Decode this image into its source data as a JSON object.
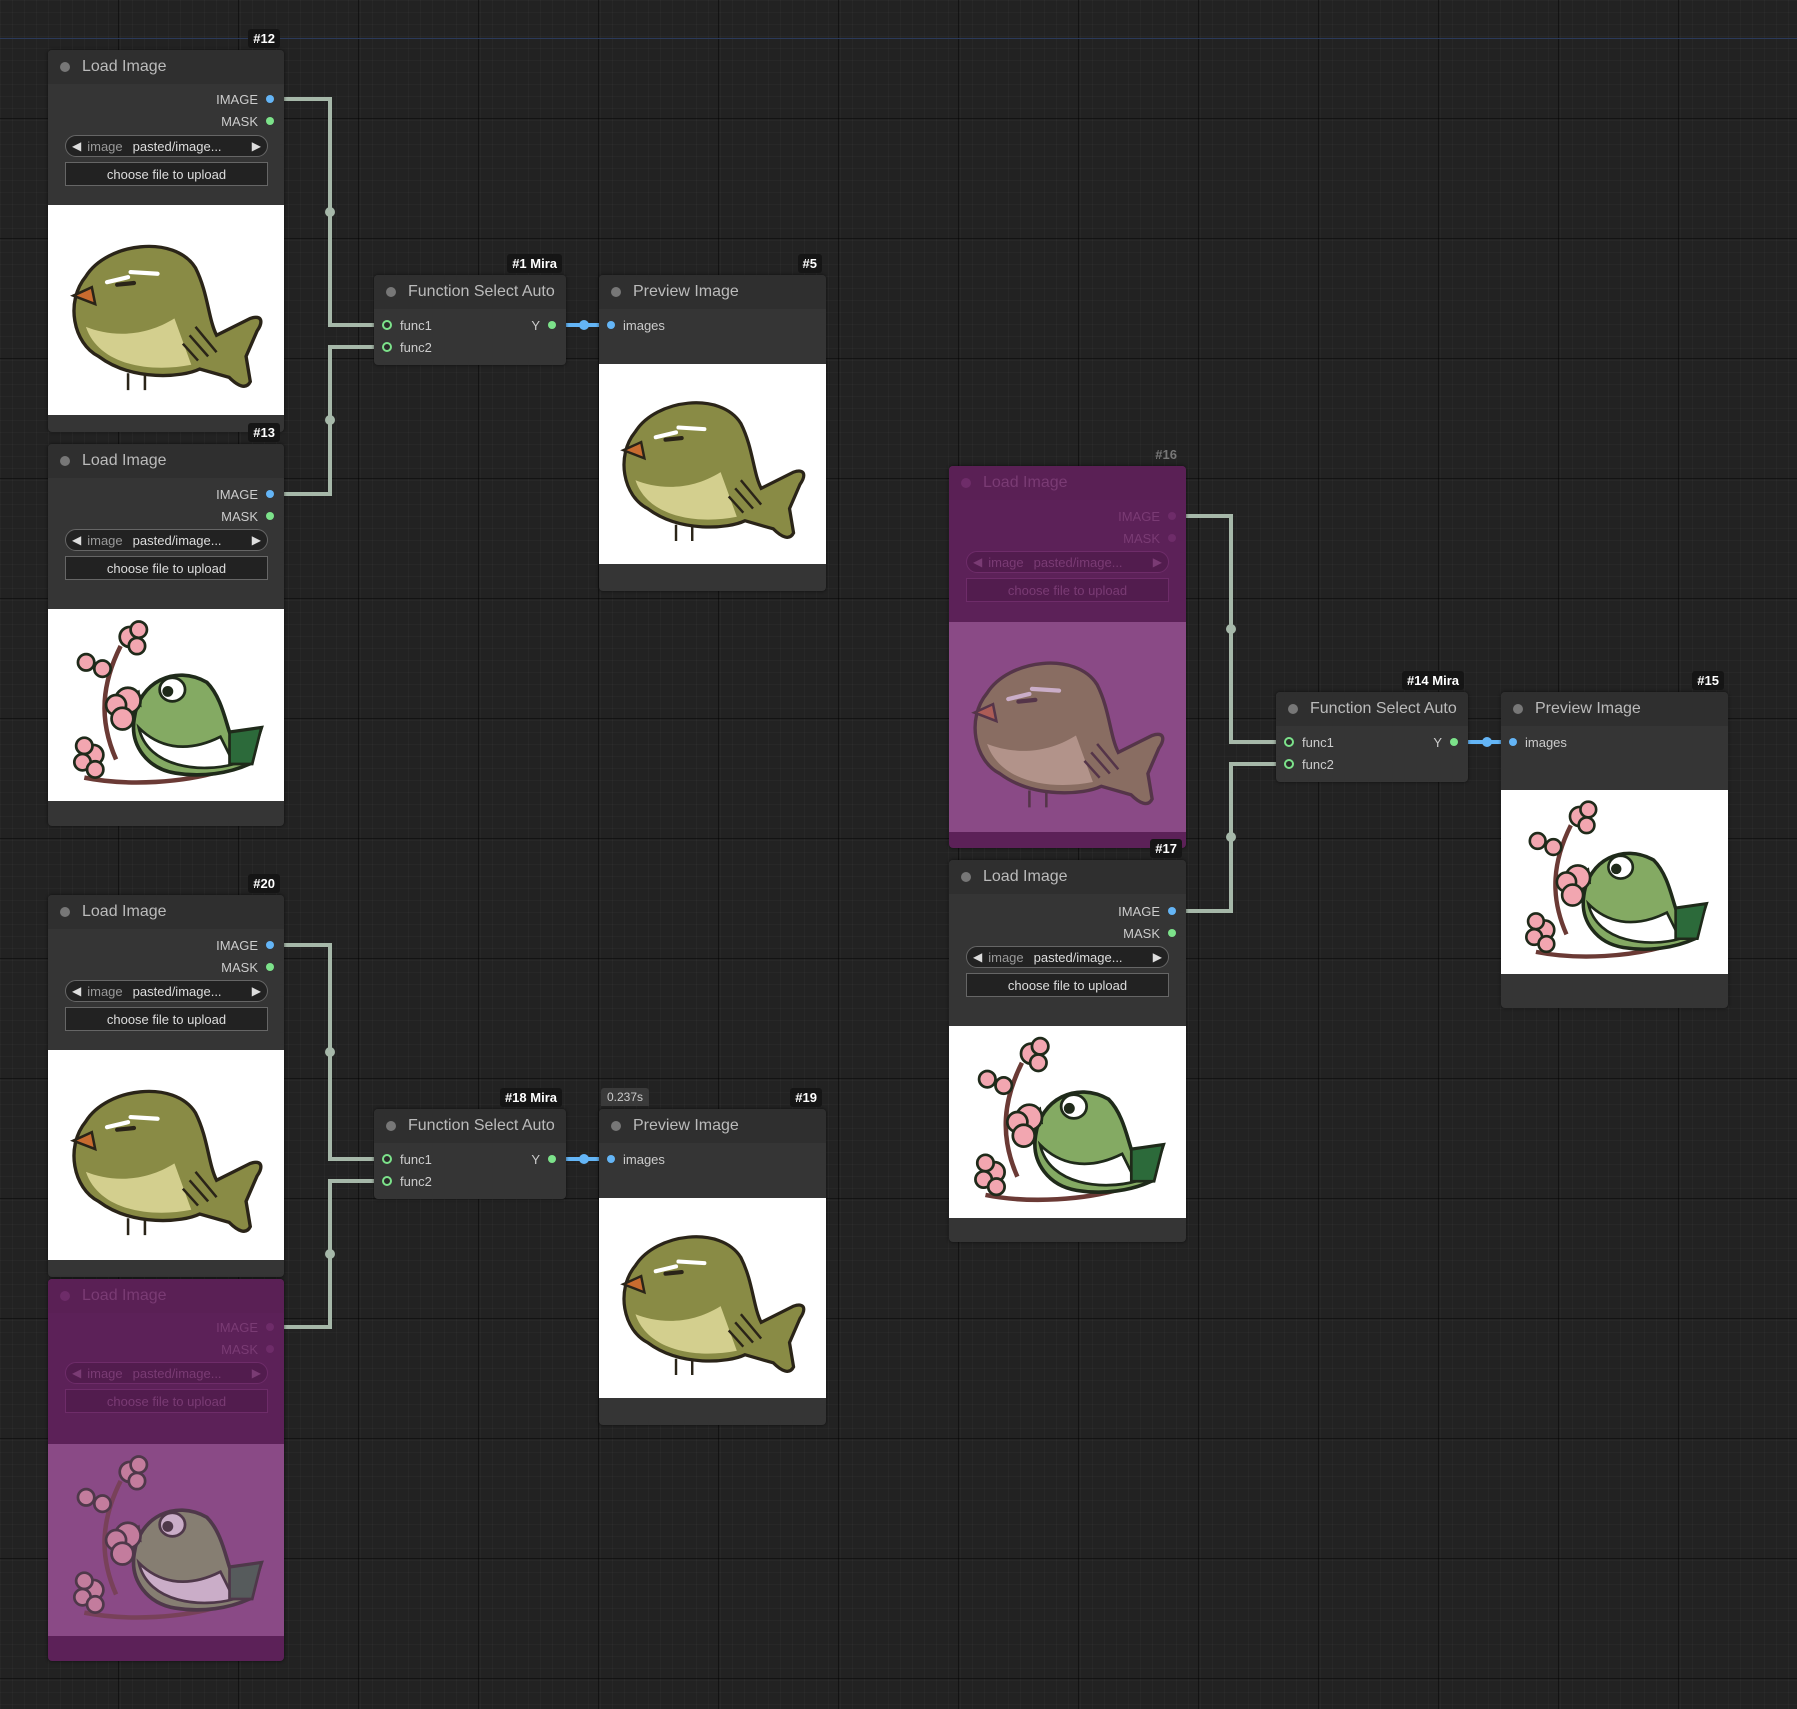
{
  "colors": {
    "canvas_bg": "#222222",
    "node_bg": "#353535",
    "bypassed_node_bg": "#5c2158",
    "link_color": "#a6b8a9",
    "image_slot": "#64b5f6",
    "mask_slot": "#7ce28a"
  },
  "nodes": {
    "n12": {
      "badge": "#12",
      "title": "Load Image",
      "out1": "IMAGE",
      "out2": "MASK",
      "combo_label": "image",
      "combo_value": "pasted/image...",
      "upload": "choose file to upload"
    },
    "n13": {
      "badge": "#13",
      "title": "Load Image",
      "out1": "IMAGE",
      "out2": "MASK",
      "combo_label": "image",
      "combo_value": "pasted/image...",
      "upload": "choose file to upload"
    },
    "n1": {
      "badge": "#1 Mira",
      "title": "Function Select Auto",
      "in1": "func1",
      "in2": "func2",
      "out1": "Y"
    },
    "n5": {
      "badge": "#5",
      "title": "Preview Image",
      "in1": "images"
    },
    "n16": {
      "badge": "#16",
      "title": "Load Image",
      "out1": "IMAGE",
      "out2": "MASK",
      "combo_label": "image",
      "combo_value": "pasted/image...",
      "upload": "choose file to upload"
    },
    "n17": {
      "badge": "#17",
      "title": "Load Image",
      "out1": "IMAGE",
      "out2": "MASK",
      "combo_label": "image",
      "combo_value": "pasted/image...",
      "upload": "choose file to upload"
    },
    "n14": {
      "badge": "#14 Mira",
      "title": "Function Select Auto",
      "in1": "func1",
      "in2": "func2",
      "out1": "Y"
    },
    "n15": {
      "badge": "#15",
      "title": "Preview Image",
      "in1": "images"
    },
    "n20": {
      "badge": "#20",
      "title": "Load Image",
      "out1": "IMAGE",
      "out2": "MASK",
      "combo_label": "image",
      "combo_value": "pasted/image...",
      "upload": "choose file to upload"
    },
    "n21": {
      "title": "Load Image",
      "out1": "IMAGE",
      "out2": "MASK",
      "combo_label": "image",
      "combo_value": "pasted/image...",
      "upload": "choose file to upload"
    },
    "n18": {
      "badge": "#18 Mira",
      "title": "Function Select Auto",
      "in1": "func1",
      "in2": "func2",
      "out1": "Y"
    },
    "n19": {
      "badge": "#19",
      "time": "0.237s",
      "title": "Preview Image",
      "in1": "images"
    }
  },
  "icons": {
    "combo_left": "arrow-left-icon",
    "combo_right": "arrow-right-icon",
    "bird_olive": "olive-bird-image",
    "bird_blossom": "green-bird-blossom-image"
  }
}
